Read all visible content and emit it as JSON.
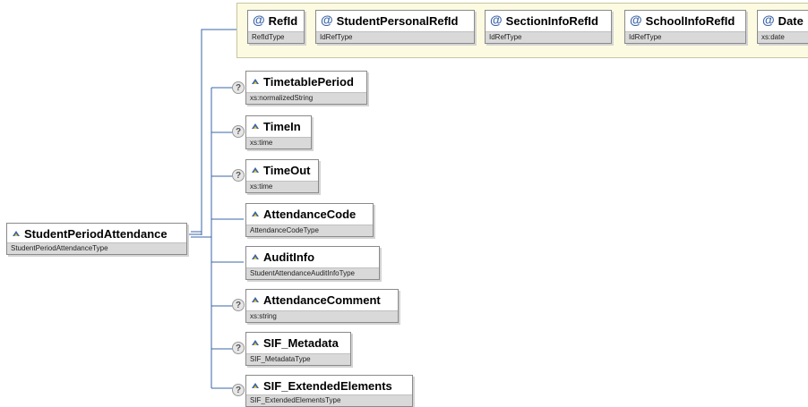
{
  "root": {
    "name": "StudentPeriodAttendance",
    "type": "StudentPeriodAttendanceType",
    "icon": "element-icon"
  },
  "attributes": [
    {
      "name": "RefId",
      "type": "RefIdType",
      "icon": "at-sign-icon"
    },
    {
      "name": "StudentPersonalRefId",
      "type": "IdRefType",
      "icon": "at-sign-icon"
    },
    {
      "name": "SectionInfoRefId",
      "type": "IdRefType",
      "icon": "at-sign-icon"
    },
    {
      "name": "SchoolInfoRefId",
      "type": "IdRefType",
      "icon": "at-sign-icon"
    },
    {
      "name": "Date",
      "type": "xs:date",
      "icon": "at-sign-icon"
    }
  ],
  "elements": [
    {
      "name": "TimetablePeriod",
      "type": "xs:normalizedString",
      "optional": true
    },
    {
      "name": "TimeIn",
      "type": "xs:time",
      "optional": true
    },
    {
      "name": "TimeOut",
      "type": "xs:time",
      "optional": true
    },
    {
      "name": "AttendanceCode",
      "type": "AttendanceCodeType",
      "optional": false
    },
    {
      "name": "AuditInfo",
      "type": "StudentAttendanceAuditInfoType",
      "optional": false
    },
    {
      "name": "AttendanceComment",
      "type": "xs:string",
      "optional": true
    },
    {
      "name": "SIF_Metadata",
      "type": "SIF_MetadataType",
      "optional": true
    },
    {
      "name": "SIF_ExtendedElements",
      "type": "SIF_ExtendedElementsType",
      "optional": true
    }
  ],
  "optional_marker": "?",
  "attribute_marker": "@",
  "colors": {
    "connector": "#3a66a8",
    "attribute_bg": "#fcfbe2",
    "type_bar": "#d9d9d9",
    "icon_blue": "#3a64a8",
    "icon_yellow": "#e8c840"
  }
}
